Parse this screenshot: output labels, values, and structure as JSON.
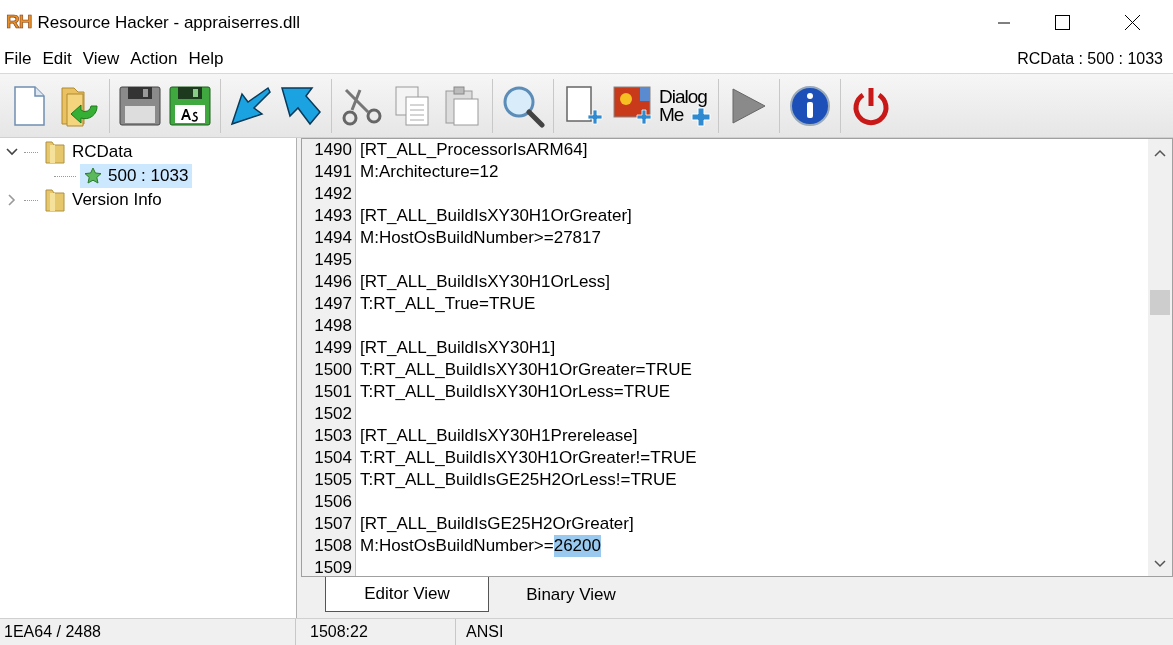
{
  "window": {
    "logo_text": "RH",
    "title": "Resource Hacker - appraiserres.dll"
  },
  "menu": [
    "File",
    "Edit",
    "View",
    "Action",
    "Help"
  ],
  "resource_id": "RCData : 500 : 1033",
  "toolbar": {
    "dialog_menu_label": [
      "Dialog",
      "Me"
    ]
  },
  "tree": [
    {
      "label": "RCData",
      "expanded": true,
      "children": [
        {
          "label": "500 : 1033",
          "selected": true
        }
      ]
    },
    {
      "label": "Version Info",
      "expanded": false
    }
  ],
  "editor": {
    "lines": [
      {
        "number": "1490",
        "text": "[RT_ALL_ProcessorIsARM64]"
      },
      {
        "number": "1491",
        "text": "M:Architecture=12"
      },
      {
        "number": "1492"
      },
      {
        "number": "1493",
        "text": "[RT_ALL_BuildIsXY30H1OrGreater]"
      },
      {
        "number": "1494",
        "text": "M:HostOsBuildNumber>=27817"
      },
      {
        "number": "1495"
      },
      {
        "number": "1496",
        "text": "[RT_ALL_BuildIsXY30H1OrLess]"
      },
      {
        "number": "1497",
        "text": "T:RT_ALL_True=TRUE"
      },
      {
        "number": "1498"
      },
      {
        "number": "1499",
        "text": "[RT_ALL_BuildIsXY30H1]"
      },
      {
        "number": "1500",
        "text": "T:RT_ALL_BuildIsXY30H1OrGreater=TRUE"
      },
      {
        "number": "1501",
        "text": "T:RT_ALL_BuildIsXY30H1OrLess=TRUE"
      },
      {
        "number": "1502"
      },
      {
        "number": "1503",
        "text": "[RT_ALL_BuildIsXY30H1Prerelease]"
      },
      {
        "number": "1504",
        "text": "T:RT_ALL_BuildIsXY30H1OrGreater!=TRUE"
      },
      {
        "number": "1505",
        "text": "T:RT_ALL_BuildIsGE25H2OrLess!=TRUE"
      },
      {
        "number": "1506"
      },
      {
        "number": "1507",
        "text": "[RT_ALL_BuildIsGE25H2OrGreater]"
      },
      {
        "number": "1508",
        "text": "M:HostOsBuildNumber>=",
        "highlight": "26200"
      },
      {
        "number": "1509"
      }
    ]
  },
  "tabs": [
    {
      "label": "Editor View",
      "selected": true
    },
    {
      "label": "Binary View",
      "selected": false
    }
  ],
  "status_bar": [
    "1EA64 / 2488",
    "1508:22",
    "ANSI"
  ]
}
